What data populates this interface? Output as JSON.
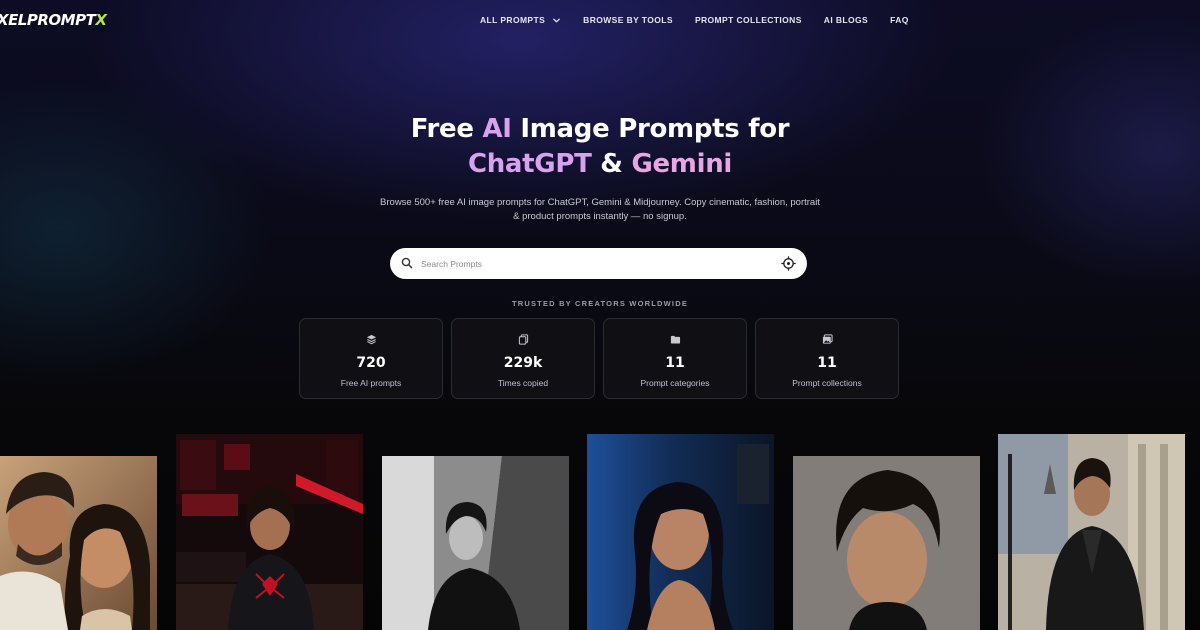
{
  "brand": {
    "logo_main": "XELPROMPT",
    "logo_accent": "X",
    "accent_color": "#b9e24a"
  },
  "nav": {
    "items": [
      {
        "label": "ALL PROMPTS",
        "has_dropdown": true
      },
      {
        "label": "BROWSE BY TOOLS"
      },
      {
        "label": "PROMPT COLLECTIONS"
      },
      {
        "label": "AI BLOGS"
      },
      {
        "label": "FAQ"
      }
    ]
  },
  "hero": {
    "title_part1": "Free ",
    "title_highlight": "AI",
    "title_part2": " Image Prompts for",
    "title_line2_a": "ChatGPT",
    "title_line2_amp": " & ",
    "title_line2_b": "Gemini",
    "subtitle_line1": "Browse 500+ free AI image prompts for ChatGPT, Gemini & Midjourney. Copy cinematic, fashion, portrait",
    "subtitle_line2": "& product prompts instantly — no signup."
  },
  "search": {
    "placeholder": "Search Prompts",
    "value": ""
  },
  "trusted_text": "TRUSTED BY CREATORS WORLDWIDE",
  "stats": [
    {
      "icon": "layers-icon",
      "value": "720",
      "label": "Free AI prompts"
    },
    {
      "icon": "copy-icon",
      "value": "229k",
      "label": "Times copied"
    },
    {
      "icon": "folder-icon",
      "value": "11",
      "label": "Prompt categories"
    },
    {
      "icon": "images-icon",
      "value": "11",
      "label": "Prompt collections"
    }
  ]
}
